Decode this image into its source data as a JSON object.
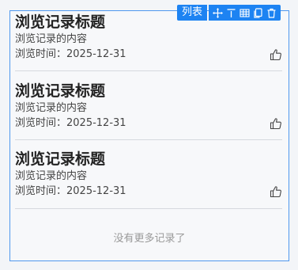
{
  "toolbar": {
    "tag_label": "列表",
    "tools": [
      "move-icon",
      "align-top-icon",
      "table-icon",
      "copy-icon",
      "delete-icon"
    ]
  },
  "records": [
    {
      "title": "浏览记录标题",
      "content": "浏览记录的内容",
      "time": "浏览时间：2025-12-31"
    },
    {
      "title": "浏览记录标题",
      "content": "浏览记录的内容",
      "time": "浏览时间：2025-12-31"
    },
    {
      "title": "浏览记录标题",
      "content": "浏览记录的内容",
      "time": "浏览时间：2025-12-31"
    }
  ],
  "footer": {
    "no_more_text": "没有更多记录了"
  },
  "colors": {
    "accent": "#1d83f2",
    "border": "#4f98ee",
    "divider": "#d6d9de"
  }
}
